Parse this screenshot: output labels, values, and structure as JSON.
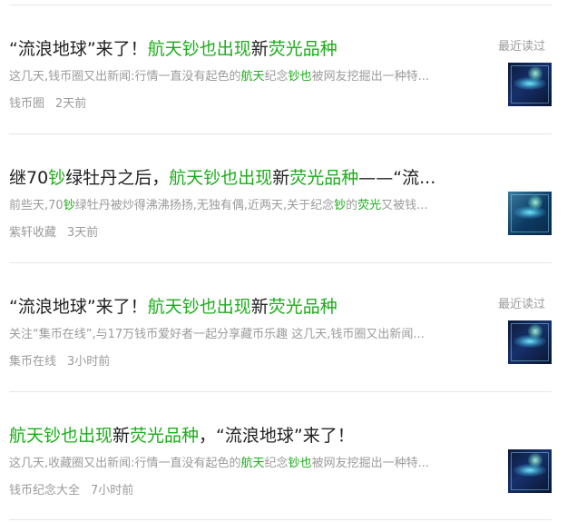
{
  "articles": [
    {
      "title": [
        {
          "t": "“流浪地球”来了！",
          "hl": false
        },
        {
          "t": "航天钞也出现",
          "hl": true
        },
        {
          "t": "新",
          "hl": false
        },
        {
          "t": "荧光品种",
          "hl": true
        }
      ],
      "recent": "最近读过",
      "desc": [
        {
          "t": "这几天,钱币圈又出新闻:行情一直没有起色的",
          "hl": false
        },
        {
          "t": "航天",
          "hl": true
        },
        {
          "t": "纪念",
          "hl": false
        },
        {
          "t": "钞也",
          "hl": true
        },
        {
          "t": "被网友挖掘出一种特...",
          "hl": false
        }
      ],
      "source": "钱币圈",
      "time": "2天前",
      "thumb": "coin-glow-image"
    },
    {
      "title": [
        {
          "t": "继70",
          "hl": false
        },
        {
          "t": "钞",
          "hl": true
        },
        {
          "t": "绿牡丹之后，",
          "hl": false
        },
        {
          "t": "航天钞也出现",
          "hl": true
        },
        {
          "t": "新",
          "hl": false
        },
        {
          "t": "荧光品种",
          "hl": true
        },
        {
          "t": "——“流...",
          "hl": false
        }
      ],
      "recent": "",
      "desc": [
        {
          "t": "前些天,70",
          "hl": false
        },
        {
          "t": "钞",
          "hl": true
        },
        {
          "t": "绿牡丹被炒得沸沸扬扬,无独有偶,近两天,关于纪念",
          "hl": false
        },
        {
          "t": "钞",
          "hl": true
        },
        {
          "t": "的",
          "hl": false
        },
        {
          "t": "荧光",
          "hl": true
        },
        {
          "t": "又被钱...",
          "hl": false
        }
      ],
      "source": "紫轩收藏",
      "time": "3天前",
      "thumb": "banknote-glow-image"
    },
    {
      "title": [
        {
          "t": "“流浪地球”来了！",
          "hl": false
        },
        {
          "t": "航天钞也出现",
          "hl": true
        },
        {
          "t": "新",
          "hl": false
        },
        {
          "t": "荧光品种",
          "hl": true
        }
      ],
      "recent": "最近读过",
      "desc": [
        {
          "t": "关注“集币在线”,与17万钱币爱好者一起分享藏币乐趣 这几天,钱币圈又出新闻...",
          "hl": false
        }
      ],
      "source": "集币在线",
      "time": "3小时前",
      "thumb": "coin-glow-image"
    },
    {
      "title": [
        {
          "t": "航天钞也出现",
          "hl": true
        },
        {
          "t": "新",
          "hl": false
        },
        {
          "t": "荧光品种",
          "hl": true
        },
        {
          "t": "，“流浪地球”来了！",
          "hl": false
        }
      ],
      "recent": "",
      "desc": [
        {
          "t": "这几天,收藏圈又出新闻:行情一直没有起色的",
          "hl": false
        },
        {
          "t": "航天",
          "hl": true
        },
        {
          "t": "纪念",
          "hl": false
        },
        {
          "t": "钞也",
          "hl": true
        },
        {
          "t": "被网友挖掘出一种特...",
          "hl": false
        }
      ],
      "source": "钱币纪念大全",
      "time": "7小时前",
      "thumb": "coin-glow-image"
    }
  ],
  "colors": {
    "highlight": "#1aad19",
    "title": "#222222",
    "meta": "#9b9b9b",
    "divider": "#e6e6e6"
  }
}
